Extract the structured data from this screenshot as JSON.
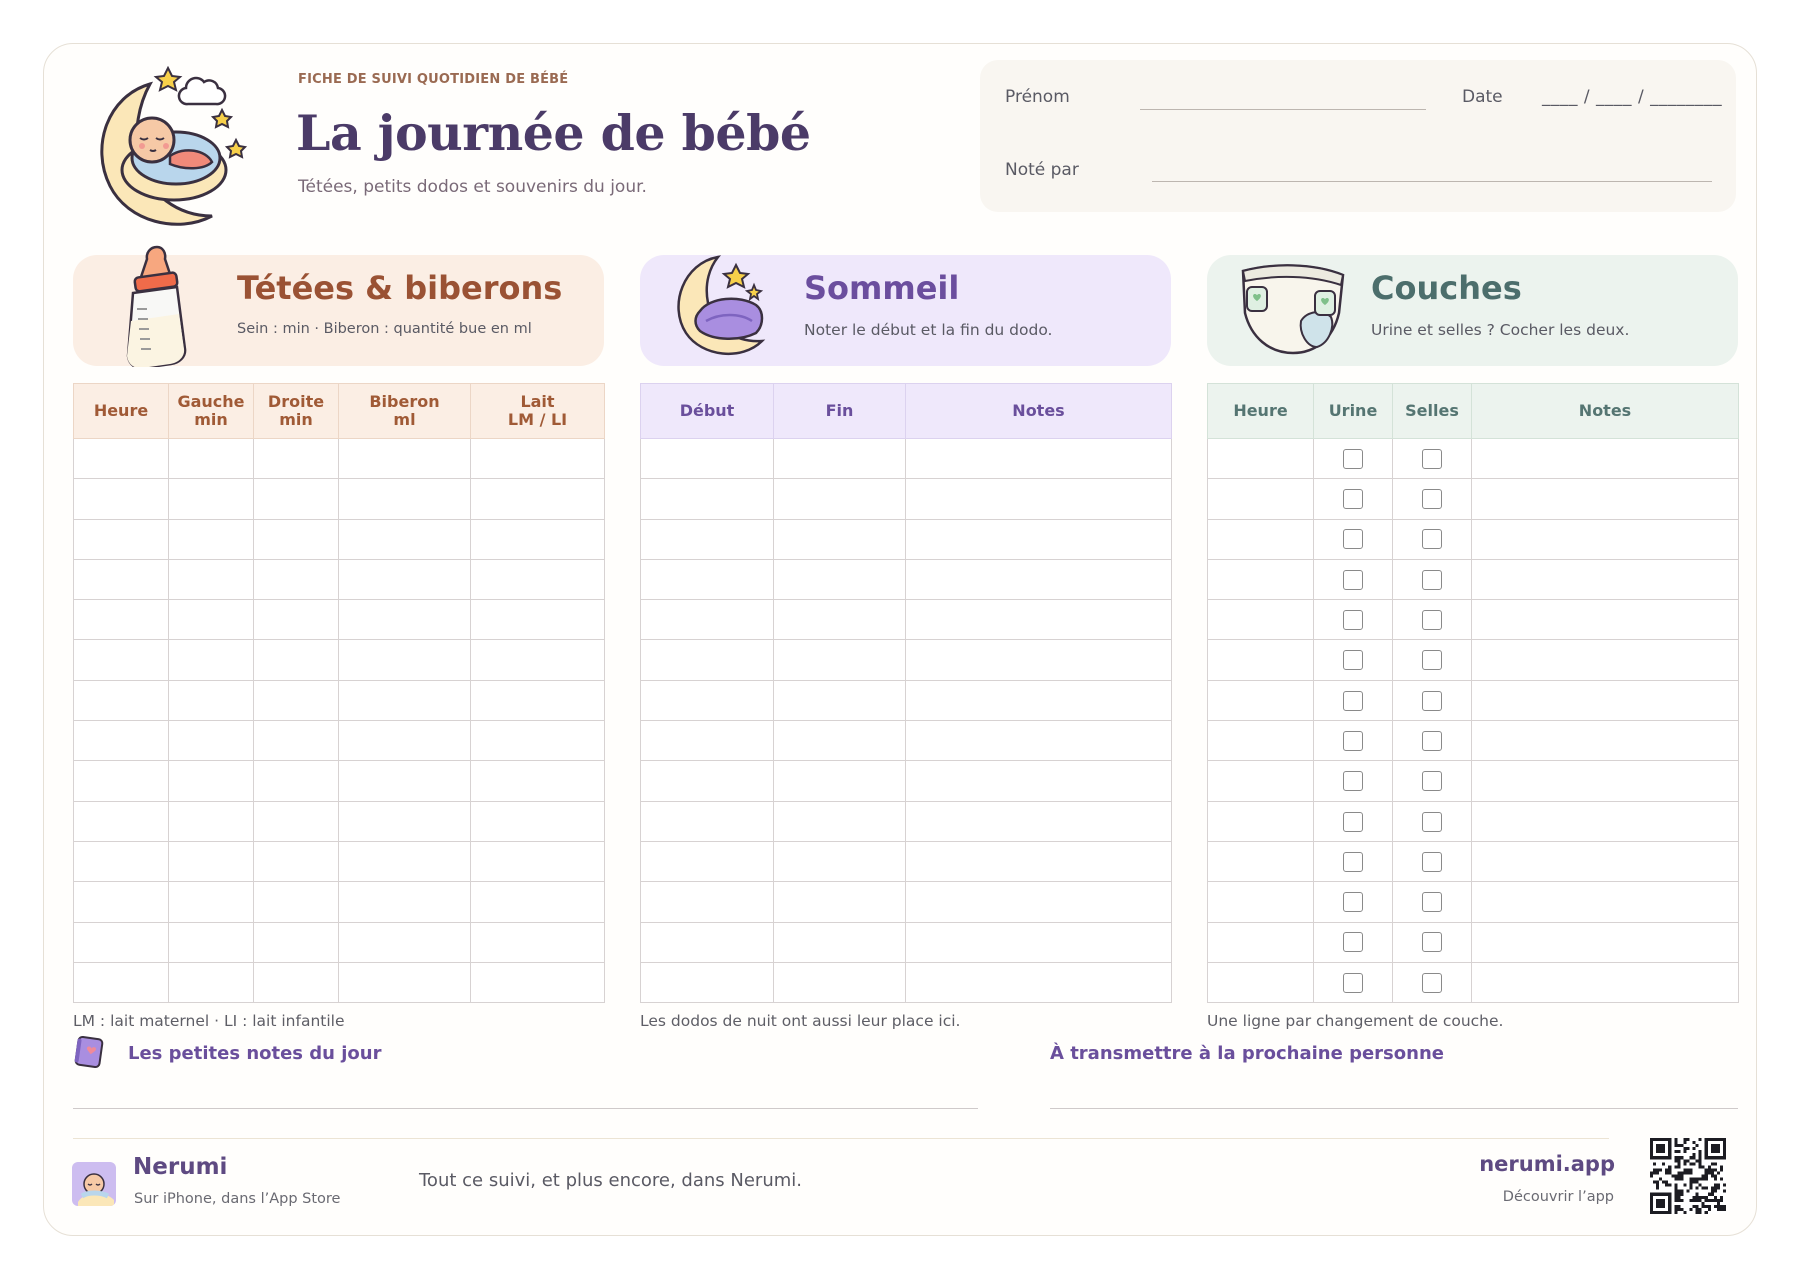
{
  "header": {
    "eyebrow": "FICHE DE SUIVI QUOTIDIEN DE BÉBÉ",
    "title": "La journée de bébé",
    "subtitle": "Tétées, petits dodos et souvenirs du jour."
  },
  "identity": {
    "first_name_label": "Prénom",
    "date_label": "Date",
    "date_template": "____ / ____ / ________",
    "noted_by_label": "Noté par"
  },
  "sections": {
    "feeding": {
      "title": "Tétées & biberons",
      "description": "Sein : min · Biberon : quantité bue en ml",
      "columns": [
        {
          "line1": "Heure",
          "line2": ""
        },
        {
          "line1": "Gauche",
          "line2": "min"
        },
        {
          "line1": "Droite",
          "line2": "min"
        },
        {
          "line1": "Biberon",
          "line2": "ml"
        },
        {
          "line1": "Lait",
          "line2": "LM / LI"
        }
      ],
      "footnote": "LM : lait maternel · LI : lait infantile"
    },
    "sleep": {
      "title": "Sommeil",
      "description": "Noter le début et la fin du dodo.",
      "columns": [
        "Début",
        "Fin",
        "Notes"
      ],
      "footnote": "Les dodos de nuit ont aussi leur place ici."
    },
    "diapers": {
      "title": "Couches",
      "description": "Urine et selles ? Cocher les deux.",
      "columns": [
        "Heure",
        "Urine",
        "Selles",
        "Notes"
      ],
      "footnote": "Une ligne par changement de couche."
    }
  },
  "row_count": 14,
  "notes": {
    "day_notes_title": "Les petites notes du jour",
    "handover_title": "À transmettre à la prochaine personne"
  },
  "footer": {
    "brand_name": "Nerumi",
    "brand_sub": "Sur iPhone, dans l’App Store",
    "tagline": "Tout ce suivi, et plus encore, dans Nerumi.",
    "site": "nerumi.app",
    "site_sub": "Découvrir l’app"
  },
  "icons": {
    "hero": "baby-on-moon-icon",
    "feeding": "baby-bottle-icon",
    "sleep": "moon-blanket-icon",
    "diapers": "diaper-icon",
    "notes": "notebook-icon",
    "brand": "nerumi-logo-icon",
    "qr": "qr-code-icon"
  },
  "colors": {
    "title": "#4b3b68",
    "feeding_accent": "#9a5234",
    "feeding_bg": "#fbeee4",
    "sleep_accent": "#6b4e9e",
    "sleep_bg": "#efe8fb",
    "diapers_accent": "#4c6e6c",
    "diapers_bg": "#ecf3ee"
  }
}
